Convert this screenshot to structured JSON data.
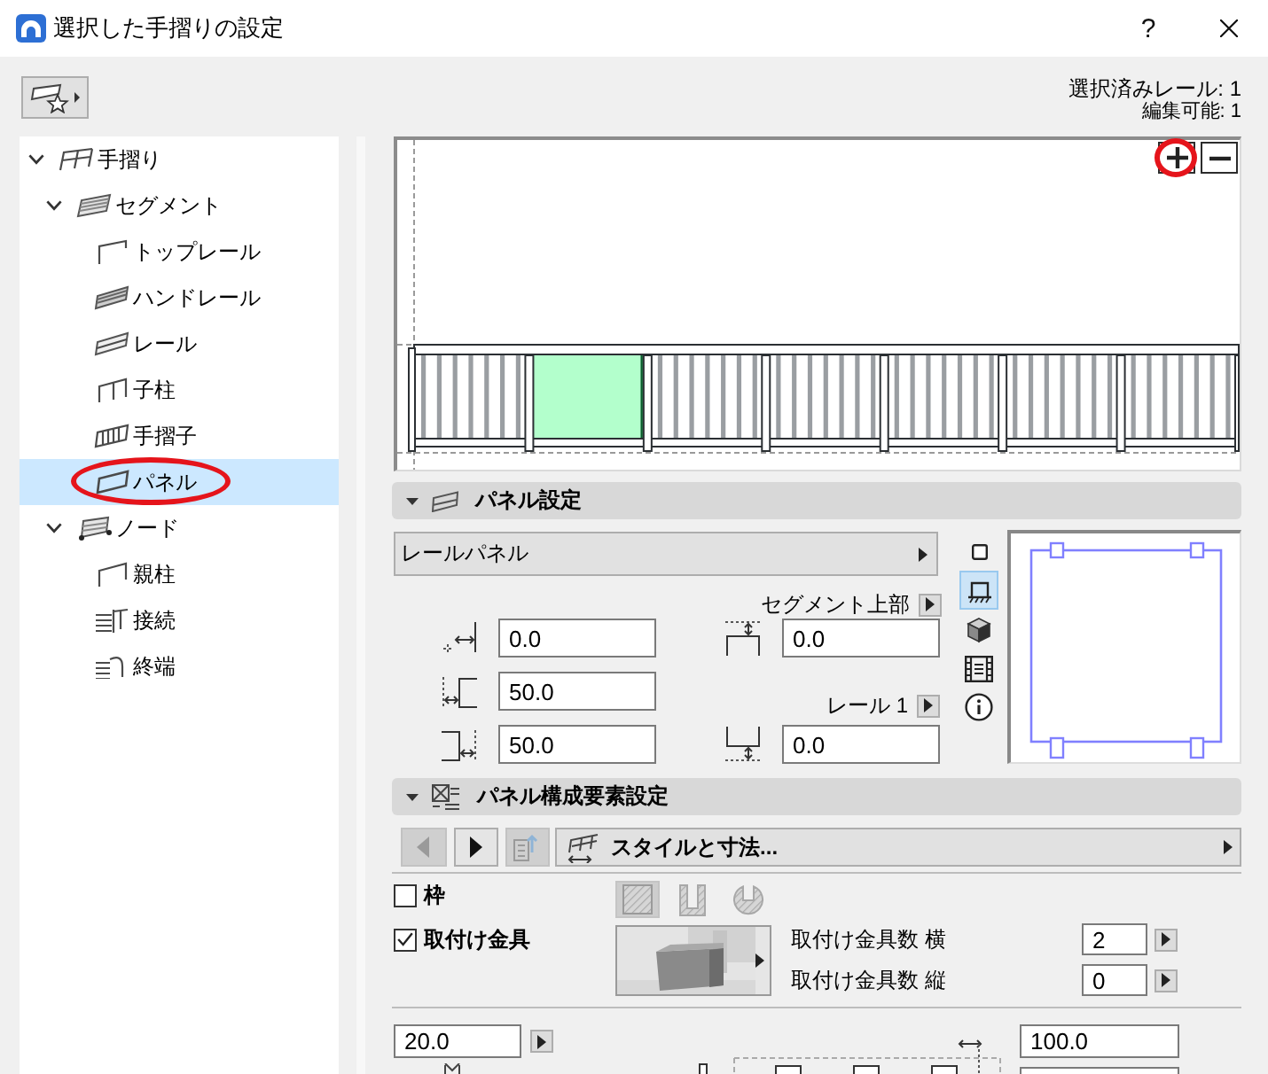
{
  "window": {
    "title": "選択した手摺りの設定",
    "help_label": "?"
  },
  "selection_info": {
    "selected": "選択済みレール: 1",
    "editable": "編集可能: 1"
  },
  "tree": [
    {
      "label": "手摺り",
      "kind": "railing",
      "expanded": true,
      "selected": false,
      "circled": false,
      "children": [
        {
          "label": "セグメント",
          "kind": "segment",
          "expanded": true,
          "selected": false,
          "circled": false,
          "children": [
            {
              "label": "トップレール",
              "kind": "top-rail",
              "selected": false,
              "circled": false
            },
            {
              "label": "ハンドレール",
              "kind": "handrail",
              "selected": false,
              "circled": false
            },
            {
              "label": "レール",
              "kind": "rail",
              "selected": false,
              "circled": false
            },
            {
              "label": "子柱",
              "kind": "post",
              "selected": false,
              "circled": false
            },
            {
              "label": "手摺子",
              "kind": "baluster",
              "selected": false,
              "circled": false
            },
            {
              "label": "パネル",
              "kind": "panel",
              "selected": true,
              "circled": true
            }
          ]
        },
        {
          "label": "ノード",
          "kind": "node",
          "expanded": true,
          "selected": false,
          "circled": false,
          "children": [
            {
              "label": "親柱",
              "kind": "newel",
              "selected": false,
              "circled": false
            },
            {
              "label": "接続",
              "kind": "connection",
              "selected": false,
              "circled": false
            },
            {
              "label": "終端",
              "kind": "end",
              "selected": false,
              "circled": false
            }
          ]
        }
      ]
    }
  ],
  "preview": {
    "zoom_in": {
      "circled": true
    },
    "bays": [
      {
        "selected": false
      },
      {
        "selected": true
      },
      {
        "selected": false
      },
      {
        "selected": false
      },
      {
        "selected": false
      },
      {
        "selected": false
      },
      {
        "selected": false
      }
    ]
  },
  "panel_settings": {
    "title": "パネル設定",
    "expanded": true,
    "panel_type": "レールパネル",
    "top_reference": "セグメント上部",
    "bottom_reference": "レール 1",
    "left_fields": [
      {
        "kind": "start-offset",
        "value": "0.0"
      },
      {
        "kind": "left-inset",
        "value": "50.0"
      },
      {
        "kind": "right-inset",
        "value": "50.0"
      }
    ],
    "right_fields": [
      {
        "kind": "top-offset",
        "value": "0.0"
      },
      {
        "kind": "bottom-offset",
        "value": "0.0"
      }
    ],
    "view_buttons": [
      {
        "kind": "plan",
        "selected": false
      },
      {
        "kind": "elevation",
        "selected": true
      },
      {
        "kind": "model",
        "selected": false
      },
      {
        "kind": "listing",
        "selected": false
      },
      {
        "kind": "info",
        "selected": false
      }
    ]
  },
  "component_settings": {
    "title": "パネル構成要素設定",
    "expanded": true,
    "nav_buttons": [
      {
        "kind": "back",
        "disabled": true
      },
      {
        "kind": "forward",
        "disabled": false
      },
      {
        "kind": "export",
        "disabled": true
      }
    ],
    "page": "スタイルと寸法...",
    "options": [
      {
        "label": "枠",
        "checked": false
      },
      {
        "label": "取付け金具",
        "checked": true
      }
    ],
    "shape_buttons": [
      {
        "kind": "square",
        "selected": true
      },
      {
        "kind": "channel",
        "selected": false
      },
      {
        "kind": "round",
        "selected": false
      }
    ],
    "counts": [
      {
        "label": "取付け金具数 横",
        "value": "2"
      },
      {
        "label": "取付け金具数 縦",
        "value": "0"
      }
    ],
    "width_value": "20.0",
    "length_value": "100.0"
  }
}
